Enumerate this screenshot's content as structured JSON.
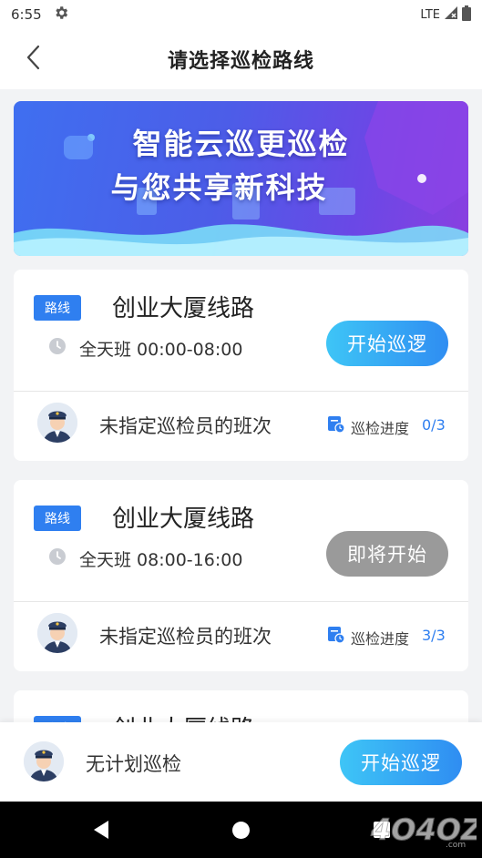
{
  "status_bar": {
    "time": "6:55",
    "network": "LTE"
  },
  "header": {
    "title": "请选择巡检路线"
  },
  "banner": {
    "line1": "智能云巡更巡检",
    "line2": "与您共享新科技"
  },
  "cards": [
    {
      "tag": "路线",
      "name": "创业大厦线路",
      "shift": "全天班 00:00-08:00",
      "action": "开始巡逻",
      "assignee": "未指定巡检员的班次",
      "progress_label": "巡检进度",
      "progress": "0/3"
    },
    {
      "tag": "路线",
      "name": "创业大厦线路",
      "shift": "全天班 08:00-16:00",
      "action": "即将开始",
      "assignee": "未指定巡检员的班次",
      "progress_label": "巡检进度",
      "progress": "3/3"
    },
    {
      "tag": "路线",
      "name": "创业大厦线路"
    }
  ],
  "bottom_bar": {
    "label": "无计划巡检",
    "action": "开始巡逻"
  },
  "colors": {
    "accent": "#2f7ff0",
    "button_gradient_start": "#3ec5f6",
    "button_gradient_end": "#2f8df2",
    "disabled": "#9a9a9a"
  },
  "icons": {
    "back": "chevron-left-icon",
    "settings": "gear-icon",
    "clock": "clock-icon",
    "progress": "progress-icon",
    "avatar": "guard-avatar"
  }
}
